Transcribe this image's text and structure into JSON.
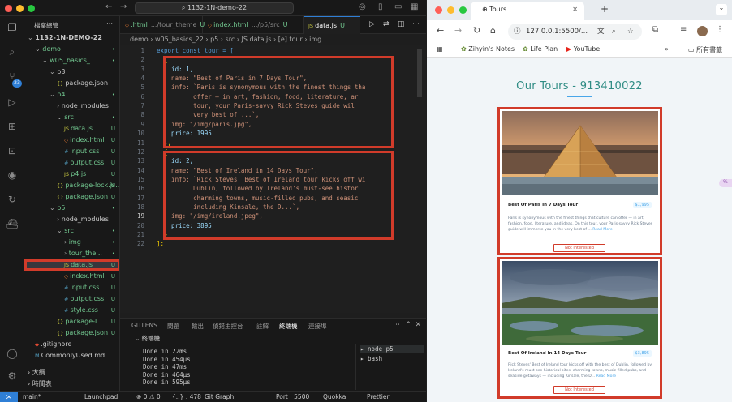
{
  "vscode": {
    "search": "1132-1N-demo-22",
    "explorer_title": "檔案總管",
    "tree": [
      {
        "label": "1132-1N-DEMO-22",
        "indent": 0,
        "arrow": "⌄",
        "kind": "root",
        "mark": ""
      },
      {
        "label": "demo",
        "indent": 1,
        "arrow": "⌄",
        "kind": "folder",
        "mark": "•"
      },
      {
        "label": "w05_basics_...",
        "indent": 2,
        "arrow": "⌄",
        "kind": "folder",
        "mark": "•"
      },
      {
        "label": "p3",
        "indent": 3,
        "arrow": "⌄",
        "kind": "folder",
        "mark": ""
      },
      {
        "label": "package.json",
        "indent": 4,
        "arrow": "",
        "kind": "json",
        "mark": ""
      },
      {
        "label": "p4",
        "indent": 3,
        "arrow": "⌄",
        "kind": "folder",
        "mark": "•"
      },
      {
        "label": "node_modules",
        "indent": 4,
        "arrow": "›",
        "kind": "folder",
        "mark": ""
      },
      {
        "label": "src",
        "indent": 4,
        "arrow": "⌄",
        "kind": "folder",
        "mark": "•"
      },
      {
        "label": "data.js",
        "indent": 5,
        "arrow": "",
        "kind": "js",
        "mark": "U"
      },
      {
        "label": "index.html",
        "indent": 5,
        "arrow": "",
        "kind": "html",
        "mark": "U"
      },
      {
        "label": "input.css",
        "indent": 5,
        "arrow": "",
        "kind": "css",
        "mark": "U"
      },
      {
        "label": "output.css",
        "indent": 5,
        "arrow": "",
        "kind": "css",
        "mark": "U"
      },
      {
        "label": "p4.js",
        "indent": 5,
        "arrow": "",
        "kind": "js",
        "mark": "U"
      },
      {
        "label": "package-lock.js...",
        "indent": 4,
        "arrow": "",
        "kind": "json",
        "mark": "U"
      },
      {
        "label": "package.json",
        "indent": 4,
        "arrow": "",
        "kind": "json",
        "mark": "U"
      },
      {
        "label": "p5",
        "indent": 3,
        "arrow": "⌄",
        "kind": "folder",
        "mark": "•"
      },
      {
        "label": "node_modules",
        "indent": 4,
        "arrow": "›",
        "kind": "folder",
        "mark": ""
      },
      {
        "label": "src",
        "indent": 4,
        "arrow": "⌄",
        "kind": "folder",
        "mark": "•"
      },
      {
        "label": "img",
        "indent": 5,
        "arrow": "›",
        "kind": "folder",
        "mark": "•"
      },
      {
        "label": "tour_the...",
        "indent": 5,
        "arrow": "›",
        "kind": "folder",
        "mark": "•"
      },
      {
        "label": "data.js",
        "indent": 5,
        "arrow": "",
        "kind": "js",
        "mark": "U"
      },
      {
        "label": "index.html",
        "indent": 5,
        "arrow": "",
        "kind": "html",
        "mark": "U"
      },
      {
        "label": "input.css",
        "indent": 5,
        "arrow": "",
        "kind": "css",
        "mark": "U"
      },
      {
        "label": "output.css",
        "indent": 5,
        "arrow": "",
        "kind": "css",
        "mark": "U"
      },
      {
        "label": "style.css",
        "indent": 5,
        "arrow": "",
        "kind": "css",
        "mark": "U"
      },
      {
        "label": "package-l...",
        "indent": 4,
        "arrow": "",
        "kind": "json",
        "mark": "U"
      },
      {
        "label": "package.json",
        "indent": 4,
        "arrow": "",
        "kind": "json",
        "mark": "U"
      },
      {
        "label": ".gitignore",
        "indent": 1,
        "arrow": "",
        "kind": "git",
        "mark": ""
      },
      {
        "label": "CommonlyUsed.md",
        "indent": 1,
        "arrow": "",
        "kind": "md",
        "mark": ""
      }
    ],
    "outline_label": "大綱",
    "timeline_label": "時間表",
    "tabs": [
      {
        "label": ".html",
        "sub": ".../tour_theme",
        "mark": "U",
        "active": false
      },
      {
        "label": "index.html",
        "sub": ".../p5/src",
        "mark": "U",
        "active": false
      },
      {
        "label": "data.js",
        "sub": "",
        "mark": "U",
        "active": true
      }
    ],
    "breadcrumb": "demo › w05_basics_22 › p5 › src › JS data.js › [e] tour › img",
    "code_lines": [
      "export const tour = [",
      "  {",
      "    id: 1,",
      "    name: \"Best of Paris in 7 Days Tour\",",
      "    info: `Paris is synonymous with the finest things tha",
      "          offer — in art, fashion, food, literature, ar",
      "          tour, your Paris-savvy Rick Steves guide wil",
      "          very best of ...`,",
      "    img: \"/img/paris.jpg\",",
      "    price: 1995",
      "  },",
      "  {",
      "    id: 2,",
      "    name: \"Best of Ireland in 14 Days Tour\",",
      "    info: `Rick Steves' Best of Ireland tour kicks off wi",
      "          Dublin, followed by Ireland's must-see histor",
      "          charming towns, music-filled pubs, and seasic",
      "          including Kinsale, the D...`,",
      "    img: \"/img/ireland.jpeg\",",
      "    price: 3895",
      "  }",
      "];"
    ],
    "panel_tabs": [
      "GITLENS",
      "問題",
      "輸出",
      "偵錯主控台",
      "註解",
      "終端機",
      "連接埠"
    ],
    "terminal_title": "終端機",
    "terminal_lines": [
      "Done in 22ms",
      "Done in 454μs",
      "Done in 47ms",
      "Done in 464μs",
      "Done in 595μs"
    ],
    "terminal_sessions": [
      "node p5",
      "bash"
    ],
    "status_items": [
      "main*",
      "Launchpad",
      "⊗ 0 ⚠ 0",
      "{..} : 478",
      "Git Graph",
      "Port : 5500",
      "Quokka",
      "Prettier"
    ],
    "activity_badge": "23"
  },
  "browser": {
    "tab_title": "Tours",
    "url": "127.0.0.1:5500/...",
    "bookmarks": [
      "Zihyin's Notes",
      "Life Plan",
      "YouTube",
      "所有書籤"
    ],
    "page_title": "Our Tours - 913410022",
    "tours": [
      {
        "name": "Best Of Paris In 7 Days Tour",
        "price": "$1,995",
        "info": "Paris is synonymous with the finest things that culture can offer — in art, fashion, food, literature, and ideas. On this tour, your Paris-savvy Rick Steves guide will immerse you in the very best of ...",
        "read_more": "Read More",
        "button": "Not Interested"
      },
      {
        "name": "Best Of Ireland In 14 Days Tour",
        "price": "$3,895",
        "info": "Rick Steves' Best of Ireland tour kicks off with the best of Dublin, followed by Ireland's must-see historical sites, charming towns, music-filled pubs, and seaside getaways — including Kinsale, the D...",
        "read_more": "Read More",
        "button": "Not Interested"
      }
    ]
  }
}
